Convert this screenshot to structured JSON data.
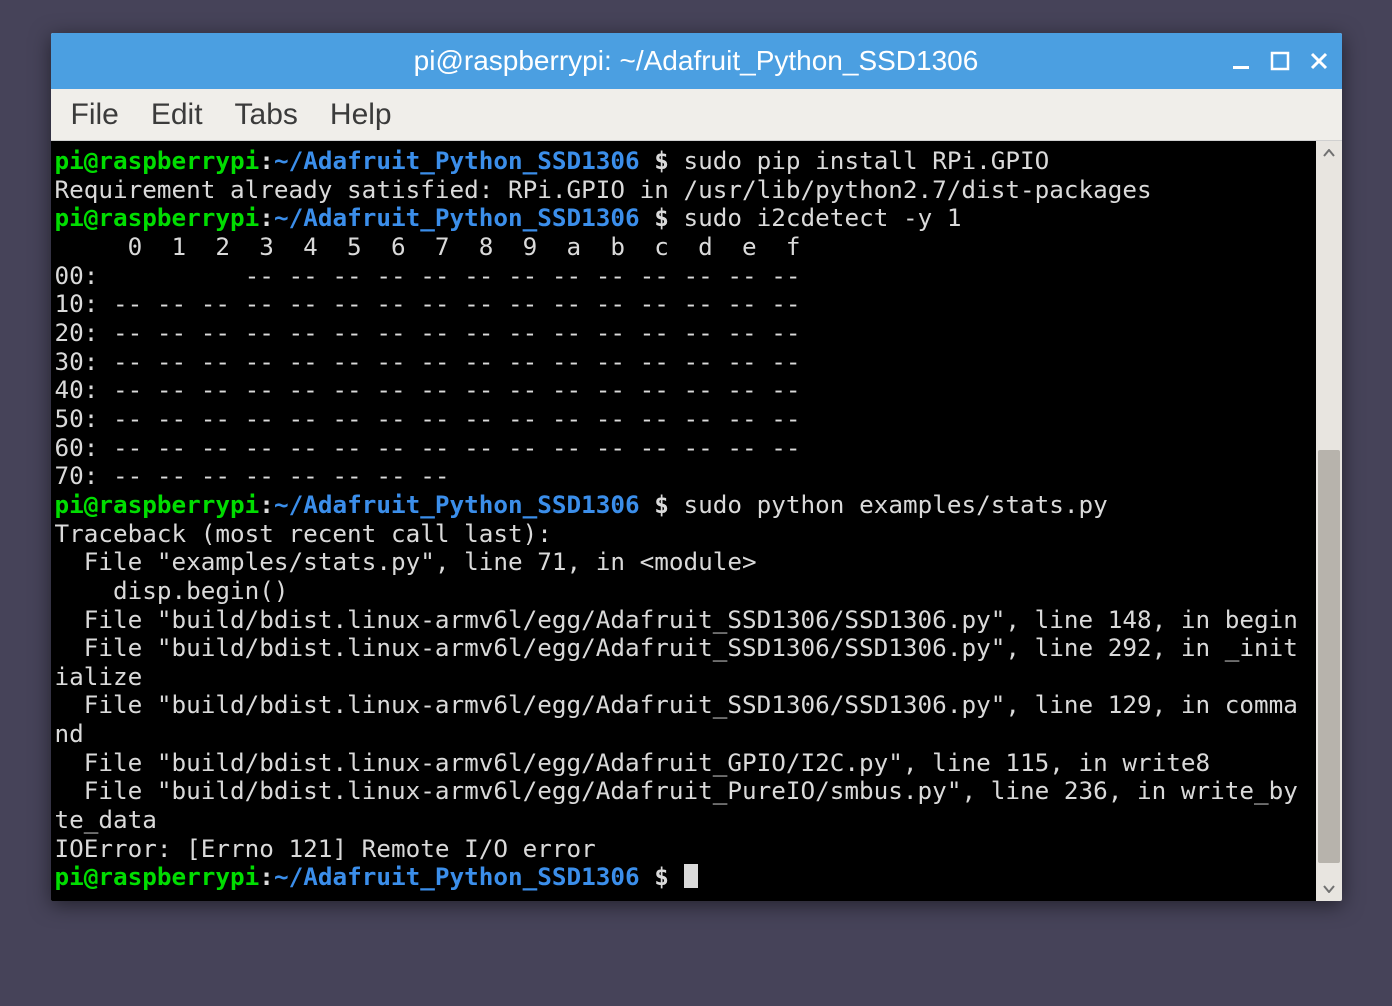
{
  "titlebar": {
    "title": "pi@raspberrypi: ~/Adafruit_Python_SSD1306"
  },
  "menubar": {
    "items": [
      "File",
      "Edit",
      "Tabs",
      "Help"
    ]
  },
  "prompt": {
    "user": "pi@raspberrypi",
    "colon": ":",
    "path": "~/Adafruit_Python_SSD1306",
    "dollar": " $ "
  },
  "lines": {
    "cmd1": "sudo pip install RPi.GPIO",
    "out1": "Requirement already satisfied: RPi.GPIO in /usr/lib/python2.7/dist-packages",
    "cmd2": "sudo i2cdetect -y 1",
    "i2c_header": "     0  1  2  3  4  5  6  7  8  9  a  b  c  d  e  f",
    "i2c_00": "00:          -- -- -- -- -- -- -- -- -- -- -- -- -- ",
    "i2c_10": "10: -- -- -- -- -- -- -- -- -- -- -- -- -- -- -- -- ",
    "i2c_20": "20: -- -- -- -- -- -- -- -- -- -- -- -- -- -- -- -- ",
    "i2c_30": "30: -- -- -- -- -- -- -- -- -- -- -- -- -- -- -- -- ",
    "i2c_40": "40: -- -- -- -- -- -- -- -- -- -- -- -- -- -- -- -- ",
    "i2c_50": "50: -- -- -- -- -- -- -- -- -- -- -- -- -- -- -- -- ",
    "i2c_60": "60: -- -- -- -- -- -- -- -- -- -- -- -- -- -- -- -- ",
    "i2c_70": "70: -- -- -- -- -- -- -- --                         ",
    "cmd3": "sudo python examples/stats.py",
    "tb1": "Traceback (most recent call last):",
    "tb2": "  File \"examples/stats.py\", line 71, in <module>",
    "tb3": "    disp.begin()",
    "tb4": "  File \"build/bdist.linux-armv6l/egg/Adafruit_SSD1306/SSD1306.py\", line 148, in begin",
    "tb5": "  File \"build/bdist.linux-armv6l/egg/Adafruit_SSD1306/SSD1306.py\", line 292, in _initialize",
    "tb6": "  File \"build/bdist.linux-armv6l/egg/Adafruit_SSD1306/SSD1306.py\", line 129, in command",
    "tb7": "  File \"build/bdist.linux-armv6l/egg/Adafruit_GPIO/I2C.py\", line 115, in write8",
    "tb8": "  File \"build/bdist.linux-armv6l/egg/Adafruit_PureIO/smbus.py\", line 236, in write_byte_data",
    "tb9": "IOError: [Errno 121] Remote I/O error"
  }
}
